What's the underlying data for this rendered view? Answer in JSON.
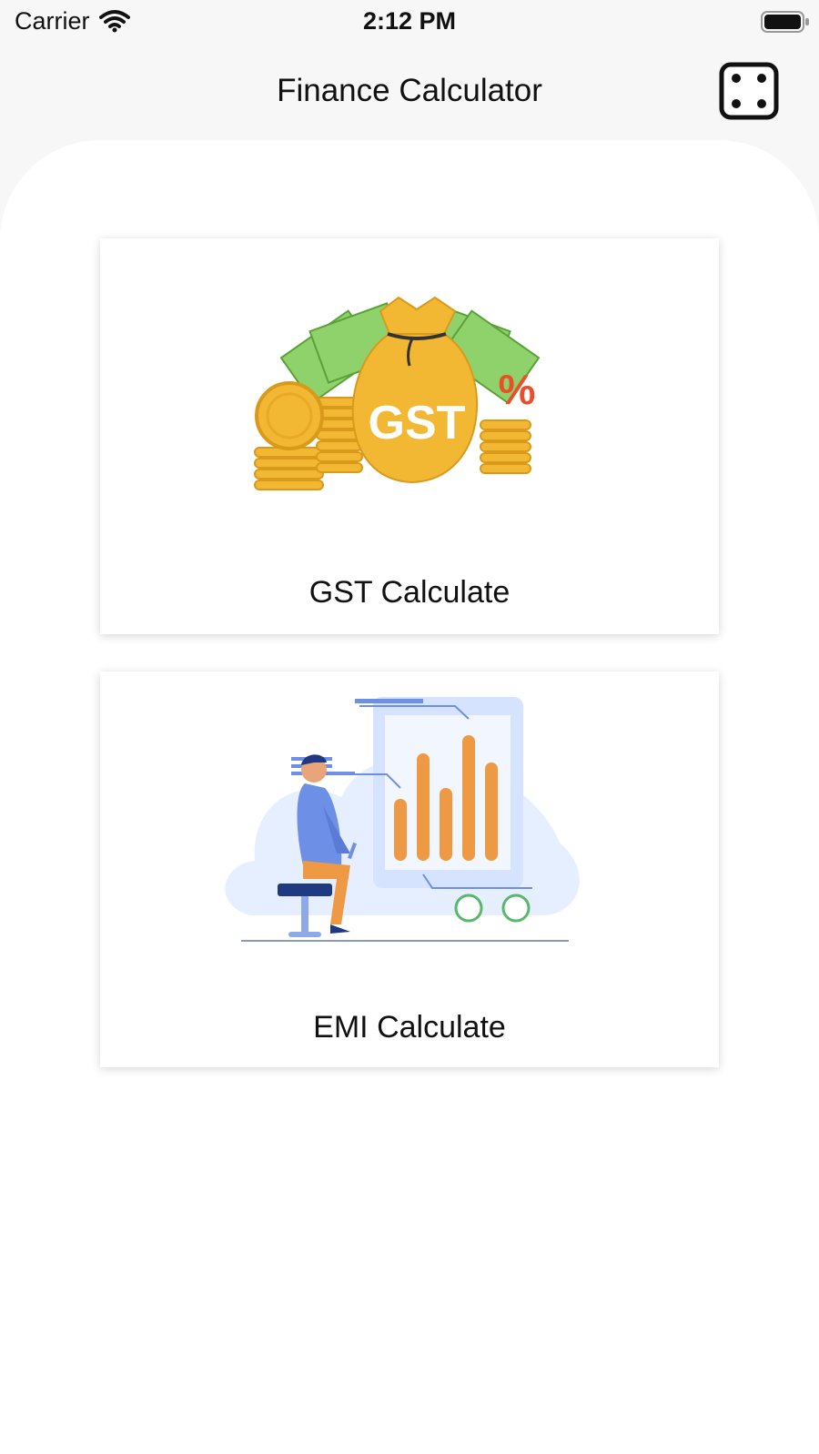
{
  "status_bar": {
    "carrier": "Carrier",
    "time": "2:12 PM"
  },
  "nav": {
    "title": "Finance Calculator"
  },
  "cards": [
    {
      "label": "GST Calculate",
      "illustration_text": "GST",
      "percent_symbol": "%"
    },
    {
      "label": "EMI Calculate"
    }
  ],
  "icons": {
    "wifi": "wifi-icon",
    "battery": "battery-icon",
    "dice": "dice-four-icon"
  },
  "colors": {
    "gold": "#f2b833",
    "gold_dark": "#d99a1c",
    "money_green": "#8fd16a",
    "percent_red": "#ea4f2b",
    "chart_orange": "#ee9a45",
    "chart_blue": "#6d8fe6",
    "blob_blue": "#e6efff"
  }
}
